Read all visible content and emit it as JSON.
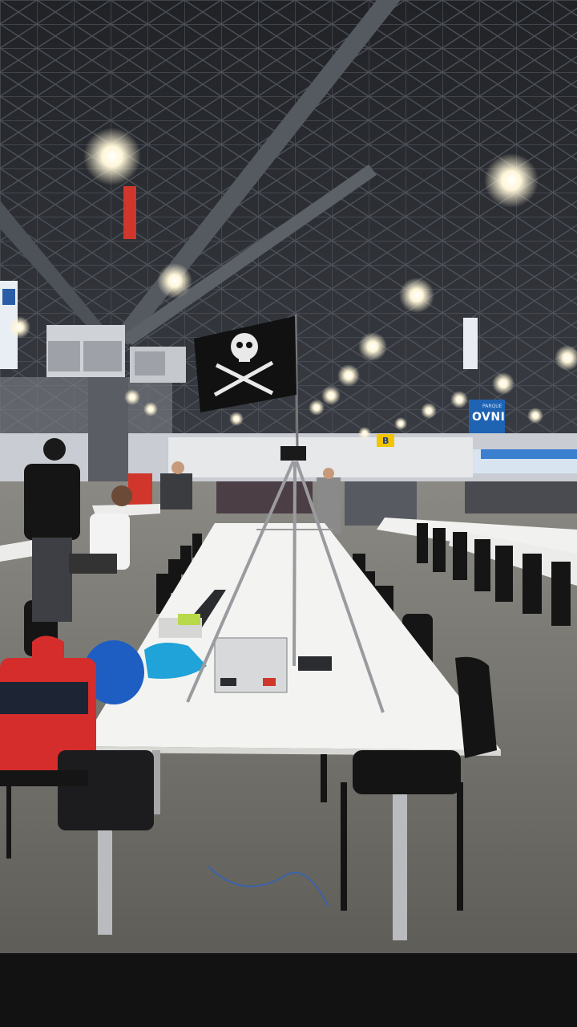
{
  "scene": {
    "description_type": "photo",
    "signs": {
      "ovni_sign": "OVNI",
      "ovni_sign_prefix": "PARQUE",
      "area_letter": "B"
    },
    "colors": {
      "ceiling": "#2a2c31",
      "floor": "#6f6d68",
      "table": "#f2f2f0",
      "chair": "#141414",
      "flag": "#111111",
      "sign_blue": "#1f63b3",
      "banner_red": "#d0362b"
    },
    "objects": [
      "pirate-flag",
      "tripod",
      "laptop",
      "router-box",
      "long-white-table",
      "black-chairs",
      "backpack",
      "people",
      "air-conditioners",
      "ceiling-lights",
      "space-frame-ceiling"
    ]
  }
}
